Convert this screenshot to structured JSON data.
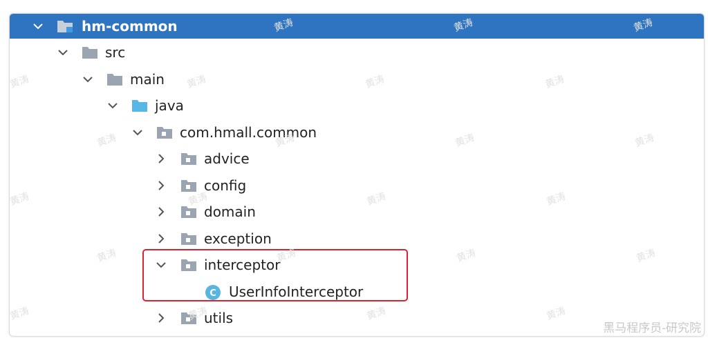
{
  "tree": {
    "root": {
      "label": "hm-common",
      "icon": "module-folder-icon"
    },
    "src": {
      "label": "src",
      "icon": "folder-icon"
    },
    "main": {
      "label": "main",
      "icon": "folder-icon"
    },
    "java": {
      "label": "java",
      "icon": "source-root-folder-icon"
    },
    "package": {
      "label": "com.hmall.common",
      "icon": "package-folder-icon"
    },
    "advice": {
      "label": "advice",
      "icon": "package-folder-icon"
    },
    "config": {
      "label": "config",
      "icon": "package-folder-icon"
    },
    "domain": {
      "label": "domain",
      "icon": "package-folder-icon"
    },
    "exception": {
      "label": "exception",
      "icon": "package-folder-icon"
    },
    "interceptor": {
      "label": "interceptor",
      "icon": "package-folder-icon"
    },
    "userinfo": {
      "label": "UserInfoInterceptor",
      "icon": "java-class-icon"
    },
    "utils": {
      "label": "utils",
      "icon": "package-folder-icon"
    }
  },
  "watermark": {
    "text": "黄涛"
  },
  "corner_watermark": {
    "text": "黑马程序员-研究院"
  },
  "colors": {
    "selection": "#2f74c0",
    "highlight_border": "#d9232e",
    "folder_gray": "#9aa5b1",
    "source_blue": "#55b7e6",
    "class_badge": "#57b6e0"
  }
}
